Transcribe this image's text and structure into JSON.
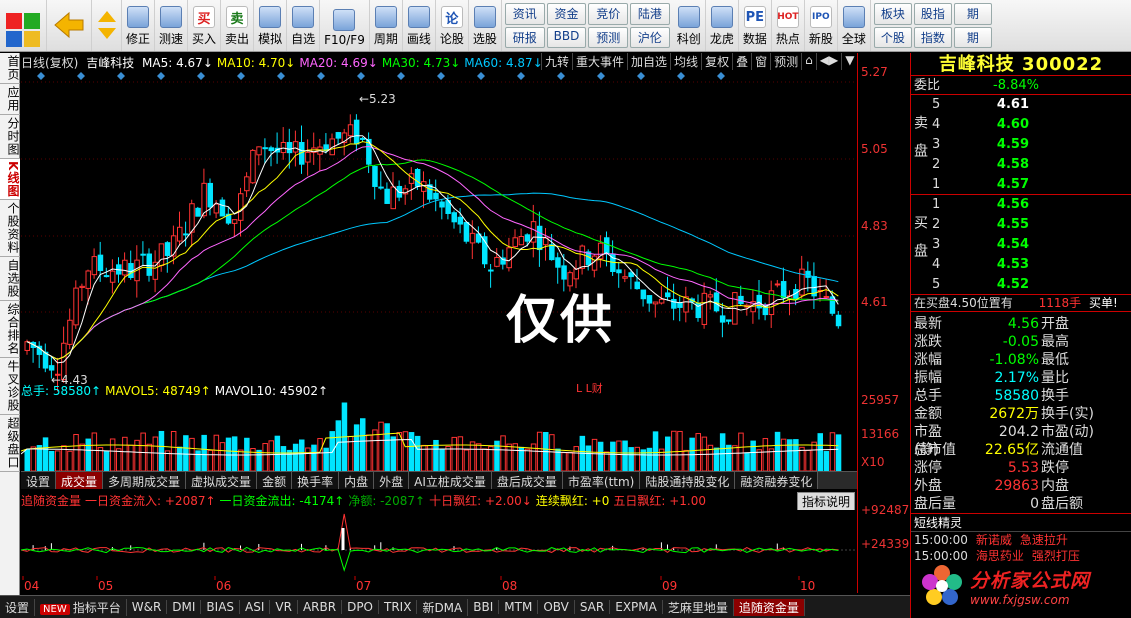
{
  "toolbar": {
    "buttons": [
      {
        "label": "修正",
        "icon": "arrow-up-down-icon"
      },
      {
        "label": "测速",
        "icon": "clock-icon"
      },
      {
        "label": "买入",
        "icon": "buy-icon",
        "glyph": "买"
      },
      {
        "label": "卖出",
        "icon": "sell-icon",
        "glyph": "卖"
      },
      {
        "label": "模拟",
        "icon": "hammer-icon"
      },
      {
        "label": "自选",
        "icon": "star-icon"
      },
      {
        "label": "F10/F9",
        "icon": "document-icon"
      },
      {
        "label": "周期",
        "icon": "cycle-icon"
      },
      {
        "label": "画线",
        "icon": "pencil-icon"
      },
      {
        "label": "论股",
        "icon": "discuss-icon",
        "glyph": "论"
      },
      {
        "label": "选股",
        "icon": "chart-select-icon"
      }
    ],
    "small_top": [
      "资讯",
      "资金",
      "竞价",
      "陆港"
    ],
    "small_bottom": [
      "研报",
      "BBD",
      "预测",
      "沪伦"
    ],
    "buttons2": [
      {
        "label": "科创",
        "icon": "chart-icon"
      },
      {
        "label": "龙虎",
        "icon": "dragon-icon"
      },
      {
        "label": "数据",
        "icon": "pe-icon",
        "glyph": "PE"
      },
      {
        "label": "热点",
        "icon": "hot-icon",
        "glyph": "HOT"
      },
      {
        "label": "新股",
        "icon": "ipo-icon",
        "glyph": "IPO"
      },
      {
        "label": "全球",
        "icon": "globe-icon"
      }
    ],
    "small_top2": [
      "板块",
      "股指",
      "期"
    ],
    "small_bottom2": [
      "个股",
      "指数",
      "期"
    ]
  },
  "left_tabs": [
    "首页",
    "应用",
    "分时图",
    "K线图",
    "个股资料",
    "自选股",
    "综合排名",
    "牛叉诊股",
    "超级盘口"
  ],
  "chart": {
    "header_prefix": "日线(复权)",
    "stock_name": "吉峰科技",
    "ma": [
      {
        "label": "MA5: 4.67↓",
        "color": "#ffffff"
      },
      {
        "label": "MA10: 4.70↓",
        "color": "#ffff00"
      },
      {
        "label": "MA20: 4.69↓",
        "color": "#ff66ff"
      },
      {
        "label": "MA30: 4.73↓",
        "color": "#00ff00"
      },
      {
        "label": "MA60: 4.87↓",
        "color": "#00c8ff"
      }
    ],
    "tools": [
      "九转",
      "重大事件",
      "加自选",
      "均线",
      "复权",
      "叠",
      "窗",
      "预测",
      "⌂",
      "◀▶",
      "▼"
    ],
    "y_ticks": [
      "5.27",
      "5.05",
      "4.83",
      "4.61"
    ],
    "high_label": "5.23",
    "low_label": "4.43",
    "markers": "L  L财",
    "watermark": "仅供",
    "x_labels": [
      "04",
      "05",
      "06",
      "07",
      "08",
      "09",
      "10"
    ]
  },
  "volume": {
    "header": [
      {
        "label": "总手: 58580↑",
        "color": "#00ffff"
      },
      {
        "label": "MAVOL5: 48749↑",
        "color": "#ffff00"
      },
      {
        "label": "MAVOL10: 45902↑",
        "color": "#ffffff"
      }
    ],
    "y_ticks": [
      "25957",
      "13166",
      "X10"
    ],
    "tabs": [
      "设置",
      "成交量",
      "多周期成交量",
      "虚拟成交量",
      "金额",
      "换手率",
      "内盘",
      "外盘",
      "AI立桩成交量",
      "盘后成交量",
      "市盈率(ttm)",
      "陆股通持股变化",
      "融资融券变化"
    ],
    "active_tab": 1
  },
  "cashflow": {
    "header": [
      {
        "label": "追随资金量",
        "color": "#ff3333"
      },
      {
        "label": "一日资金流入: +2087↑",
        "color": "#ff3333"
      },
      {
        "label": "一日资金流出: -4174↑",
        "color": "#00ff00"
      },
      {
        "label": "净额: -2087↑",
        "color": "#00aa00"
      },
      {
        "label": "十日飘红: +2.00↓",
        "color": "#ff3333"
      },
      {
        "label": "连续飘红: +0",
        "color": "#ffff00"
      },
      {
        "label": "五日飘红: +1.00",
        "color": "#ff3333"
      }
    ],
    "explain_button": "指标说明",
    "y_ticks": [
      "+92487",
      "+24339"
    ]
  },
  "statusbar": {
    "items": [
      "设置",
      "指标平台",
      "W&R",
      "DMI",
      "BIAS",
      "ASI",
      "VR",
      "ARBR",
      "DPO",
      "TRIX",
      "新DMA",
      "BBI",
      "MTM",
      "OBV",
      "SAR",
      "EXPMA",
      "芝麻里地量",
      "追随资金量"
    ],
    "new_badge": "NEW",
    "active": "追随资金量"
  },
  "quote": {
    "title": "吉峰科技 300022",
    "weibi_label": "委比",
    "weibi_value": "-8.84%",
    "sell_side": "卖盘",
    "buy_side": "买盘",
    "asks": [
      [
        "5",
        "4.61"
      ],
      [
        "4",
        "4.60"
      ],
      [
        "3",
        "4.59"
      ],
      [
        "2",
        "4.58"
      ],
      [
        "1",
        "4.57"
      ]
    ],
    "bids": [
      [
        "1",
        "4.56"
      ],
      [
        "2",
        "4.55"
      ],
      [
        "3",
        "4.54"
      ],
      [
        "4",
        "4.53"
      ],
      [
        "5",
        "4.52"
      ]
    ],
    "buy_notice": "在买盘4.50位置有",
    "buy_notice_vol": "1118手",
    "buy_notice_tail": "买单!",
    "stats": [
      {
        "k": "最新",
        "v": "4.56",
        "vc": "g",
        "k2": "开盘"
      },
      {
        "k": "涨跌",
        "v": "-0.05",
        "vc": "g",
        "k2": "最高"
      },
      {
        "k": "涨幅",
        "v": "-1.08%",
        "vc": "g",
        "k2": "最低"
      },
      {
        "k": "振幅",
        "v": "2.17%",
        "vc": "c",
        "k2": "量比"
      },
      {
        "k": "总手",
        "v": "58580",
        "vc": "c",
        "k2": "换手"
      },
      {
        "k": "金额",
        "v": "2672万",
        "vc": "y",
        "k2": "换手(实)"
      },
      {
        "k": "市盈(静)",
        "v": "204.2",
        "vc": "w",
        "k2": "市盈(动)"
      },
      {
        "k": "总市值",
        "v": "22.65亿",
        "vc": "y",
        "k2": "流通值"
      },
      {
        "k": "涨停",
        "v": "5.53",
        "vc": "r",
        "k2": "跌停"
      },
      {
        "k": "外盘",
        "v": "29863",
        "vc": "r",
        "k2": "内盘"
      },
      {
        "k": "盘后量",
        "v": "0",
        "vc": "w",
        "k2": "盘后额"
      }
    ],
    "short_title": "短线精灵",
    "short_rows": [
      {
        "t": "15:00:00",
        "a": "新诺威",
        "b": "急速拉升"
      },
      {
        "t": "15:00:00",
        "a": "海思药业",
        "b": "强烈打压"
      }
    ]
  },
  "logo": {
    "text": "分析家公式网",
    "url": "www.fxjgsw.com"
  },
  "colors": {
    "up": "#ff3333",
    "down": "#00e5ff",
    "accent": "#c00000"
  }
}
